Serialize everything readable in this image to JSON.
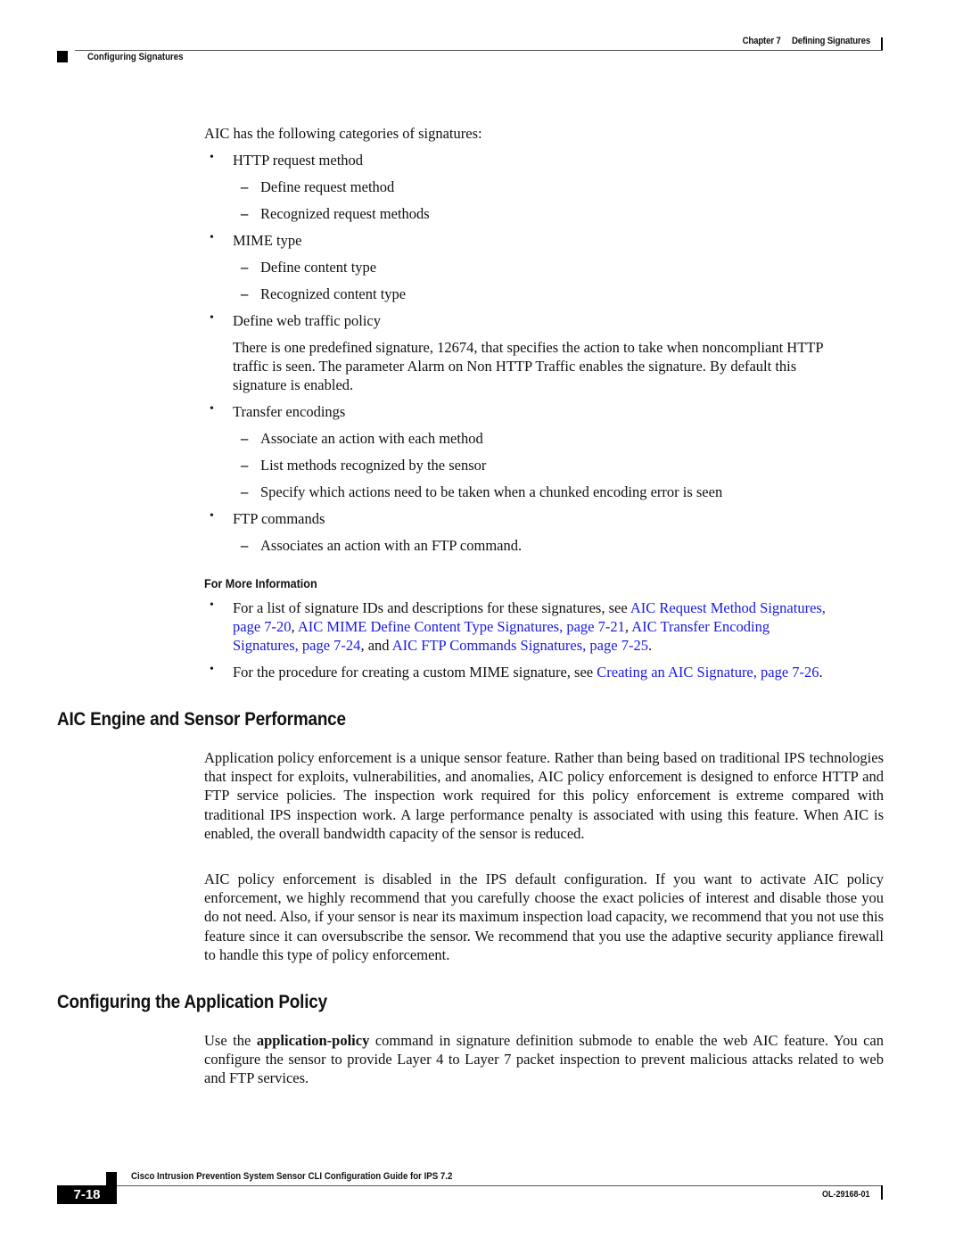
{
  "header": {
    "chapter_label": "Chapter 7",
    "chapter_title": "Defining Signatures",
    "section": "Configuring Signatures"
  },
  "intro": "AIC has the following categories of signatures:",
  "categories": [
    {
      "label": "HTTP request method",
      "subitems": [
        "Define request method",
        "Recognized request methods"
      ]
    },
    {
      "label": "MIME type",
      "subitems": [
        "Define content type",
        "Recognized content type"
      ]
    },
    {
      "label": "Define web traffic policy",
      "note_lines": [
        "There is one predefined signature, 12674, that specifies the action to take when noncompliant HTTP",
        "traffic is seen. The parameter Alarm on Non HTTP Traffic enables the signature. By default this",
        "signature is enabled."
      ]
    },
    {
      "label": "Transfer encodings",
      "subitems": [
        "Associate an action with each method",
        "List methods recognized by the sensor",
        "Specify which actions need to be taken when a chunked encoding error is seen"
      ]
    },
    {
      "label": "FTP commands",
      "subitems": [
        "Associates an action with an FTP command."
      ]
    }
  ],
  "more_info": {
    "heading": "For More Information",
    "item1": {
      "prefix": "For a list of signature IDs and descriptions for these signatures, see ",
      "link1": "AIC Request Method Signatures,",
      "link1b": "page 7-20",
      "sep1": ", ",
      "link2": "AIC MIME Define Content Type Signatures, page 7-21",
      "sep2": ", ",
      "link3": "AIC Transfer Encoding",
      "link3b": "Signatures, page 7-24",
      "sep3": ", and ",
      "link4": "AIC FTP Commands Signatures, page 7-25",
      "suffix": "."
    },
    "item2": {
      "prefix": "For the procedure for creating a custom MIME signature, see ",
      "link": "Creating an AIC Signature, page 7-26",
      "suffix": "."
    }
  },
  "section_performance": {
    "title": "AIC Engine and Sensor Performance",
    "para1": "Application policy enforcement is a unique sensor feature. Rather than being based on traditional IPS technologies that inspect for exploits, vulnerabilities, and anomalies, AIC policy enforcement is designed to enforce HTTP and FTP service policies. The inspection work required for this policy enforcement is extreme compared with traditional IPS inspection work. A large performance penalty is associated with using this feature. When AIC is enabled, the overall bandwidth capacity of the sensor is reduced.",
    "para2": "AIC policy enforcement is disabled in the IPS default configuration. If you want to activate AIC policy enforcement, we highly recommend that you carefully choose the exact policies of interest and disable those you do not need. Also, if your sensor is near its maximum inspection load capacity, we recommend that you not use this feature since it can oversubscribe the sensor. We recommend that you use the adaptive security appliance firewall to handle this type of policy enforcement."
  },
  "section_policy": {
    "title": "Configuring the Application Policy",
    "para_prefix": "Use the ",
    "para_command": "application-policy",
    "para_suffix": " command in signature definition submode to enable the web AIC feature. You can configure the sensor to provide Layer 4 to Layer 7 packet inspection to prevent malicious attacks related to web and FTP services."
  },
  "footer": {
    "guide_title": "Cisco Intrusion Prevention System Sensor CLI Configuration Guide for IPS 7.2",
    "page_number": "7-18",
    "doc_number": "OL-29168-01"
  },
  "colors": {
    "link": "#1a1ae0",
    "text": "#111111"
  }
}
